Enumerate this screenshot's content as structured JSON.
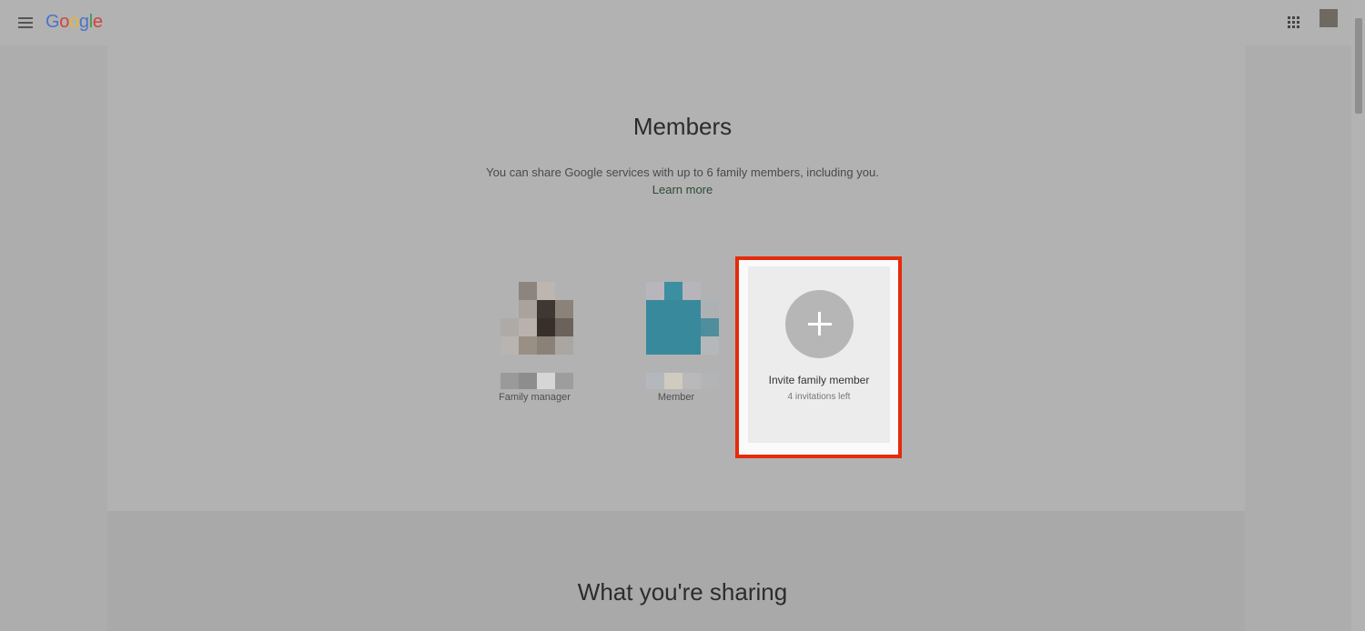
{
  "header": {
    "logo_letters": [
      {
        "char": "G",
        "color": "#4a74c9"
      },
      {
        "char": "o",
        "color": "#d0463a"
      },
      {
        "char": "o",
        "color": "#e3b63a"
      },
      {
        "char": "g",
        "color": "#4a74c9"
      },
      {
        "char": "l",
        "color": "#3c9a52"
      },
      {
        "char": "e",
        "color": "#d0463a"
      }
    ],
    "menu_icon": "hamburger-menu-icon",
    "apps_icon": "apps-grid-icon",
    "avatar_color": "#6e6a62"
  },
  "members": {
    "title": "Members",
    "description": "You can share Google services with up to 6 family members, including you.",
    "learn_more": "Learn more",
    "list": [
      {
        "role": "Family manager"
      },
      {
        "role": "Member"
      }
    ],
    "invite": {
      "label": "Invite family member",
      "sublabel": "4 invitations left",
      "icon": "plus-icon",
      "highlight_color": "#e42b0c"
    }
  },
  "sharing": {
    "title": "What you're sharing"
  }
}
